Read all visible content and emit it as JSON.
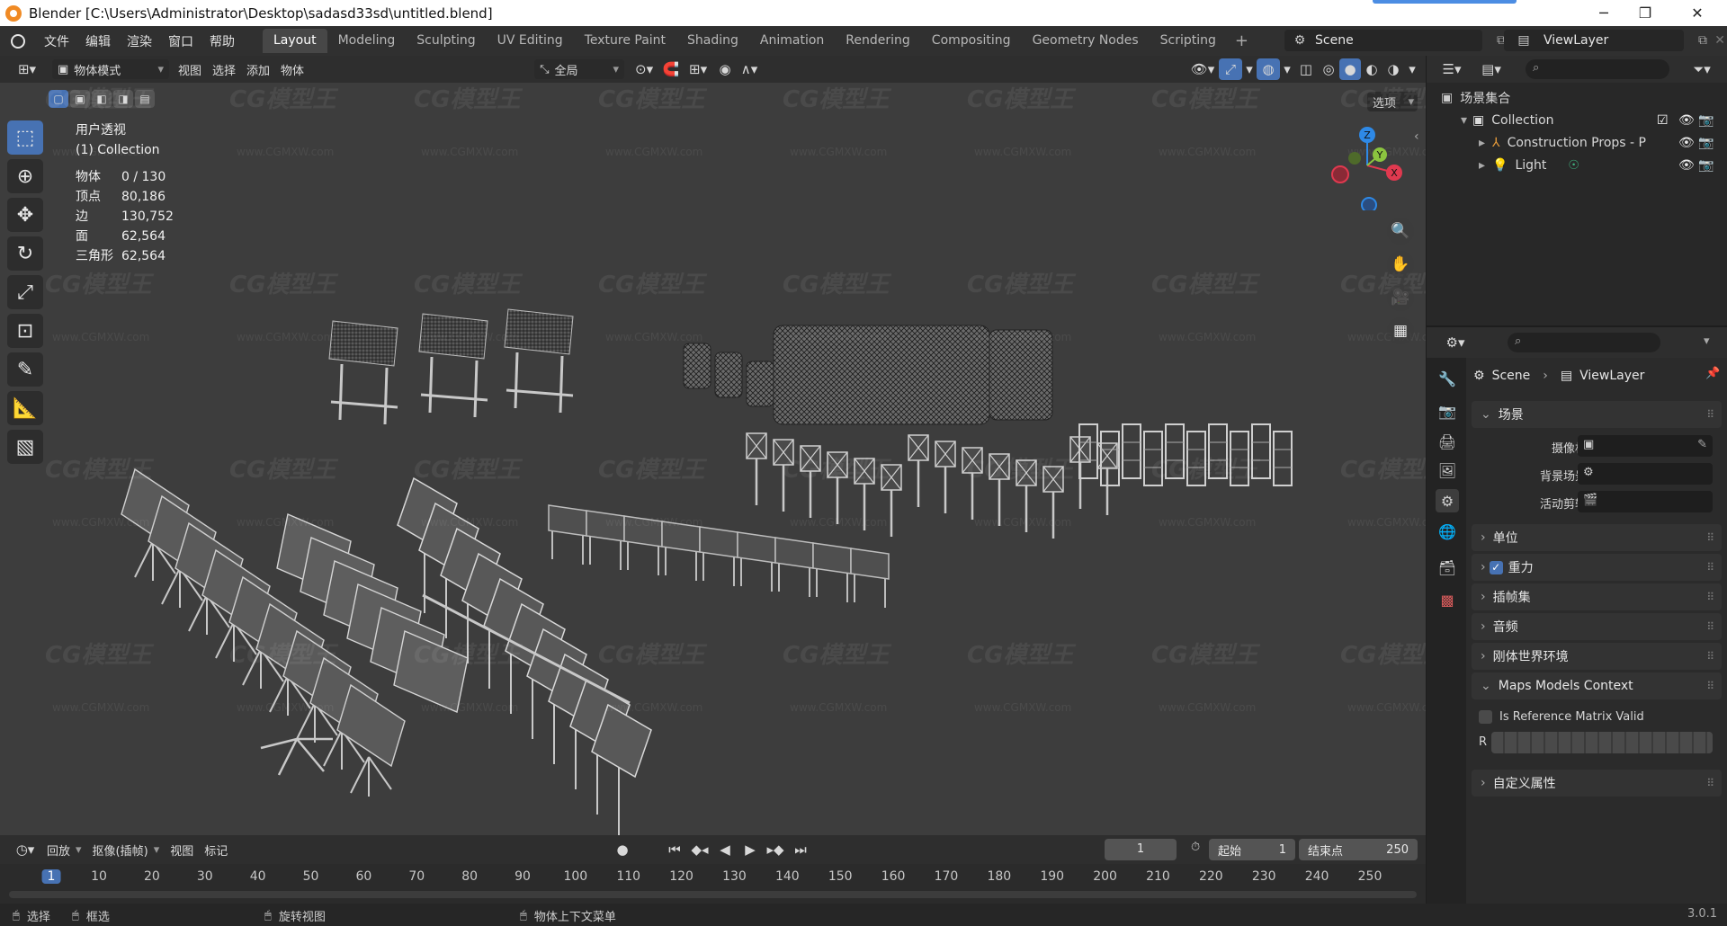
{
  "window": {
    "title": "Blender [C:\\Users\\Administrator\\Desktop\\sadasd33sd\\untitled.blend]"
  },
  "menus": [
    "文件",
    "编辑",
    "渲染",
    "窗口",
    "帮助"
  ],
  "workspaces": [
    "Layout",
    "Modeling",
    "Sculpting",
    "UV Editing",
    "Texture Paint",
    "Shading",
    "Animation",
    "Rendering",
    "Compositing",
    "Geometry Nodes",
    "Scripting"
  ],
  "active_workspace": "Layout",
  "scene_selector": "Scene",
  "viewlayer_selector": "ViewLayer",
  "viewport": {
    "mode": "物体模式",
    "header_menus": [
      "视图",
      "选择",
      "添加",
      "物体"
    ],
    "transform_orientation": "全局",
    "options_label": "选项",
    "overlay_title": "用户透视",
    "overlay_collection": "(1) Collection",
    "stats": [
      {
        "label": "物体",
        "value": "0 / 130"
      },
      {
        "label": "顶点",
        "value": "80,186"
      },
      {
        "label": "边",
        "value": "130,752"
      },
      {
        "label": "面",
        "value": "62,564"
      },
      {
        "label": "三角形",
        "value": "62,564"
      }
    ],
    "watermark": "CG模型王",
    "watermark_url": "www.CGMXW.com",
    "gizmo_axes": {
      "z": "Z",
      "x": "X",
      "y": "Y"
    }
  },
  "outliner": {
    "root": "场景集合",
    "items": [
      {
        "label": "Collection",
        "level": 1
      },
      {
        "label": "Construction Props - P",
        "level": 2
      },
      {
        "label": "Light",
        "level": 2
      }
    ]
  },
  "properties": {
    "breadcrumb_scene": "Scene",
    "breadcrumb_viewlayer": "ViewLayer",
    "section_scene": "场景",
    "camera_label": "摄像机",
    "background_label": "背景场景",
    "active_clip_label": "活动剪辑",
    "panels": [
      "单位",
      "重力",
      "插帧集",
      "音频",
      "刚体世界环境",
      "Maps Models Context"
    ],
    "gravity_checked": true,
    "ref_matrix_label": "Is Reference Matrix Valid",
    "r_label": "R",
    "custom_props": "自定义属性"
  },
  "timeline": {
    "menus": [
      "回放",
      "抠像(插帧)",
      "视图",
      "标记"
    ],
    "current_frame": "1",
    "start_label": "起始",
    "start_value": "1",
    "end_label": "结束点",
    "end_value": "250",
    "ticks": [
      "1",
      "10",
      "20",
      "30",
      "40",
      "50",
      "60",
      "70",
      "80",
      "90",
      "100",
      "110",
      "120",
      "130",
      "140",
      "150",
      "160",
      "170",
      "180",
      "190",
      "200",
      "210",
      "220",
      "230",
      "240",
      "250"
    ]
  },
  "statusbar": {
    "select": "选择",
    "box_select": "框选",
    "rotate_view": "旋转视图",
    "object_context": "物体上下文菜单",
    "version": "3.0.1"
  },
  "colors": {
    "accent": "#4772b3",
    "axis_x": "#e0394f",
    "axis_y": "#8bc43f",
    "axis_z": "#2e89e6"
  }
}
